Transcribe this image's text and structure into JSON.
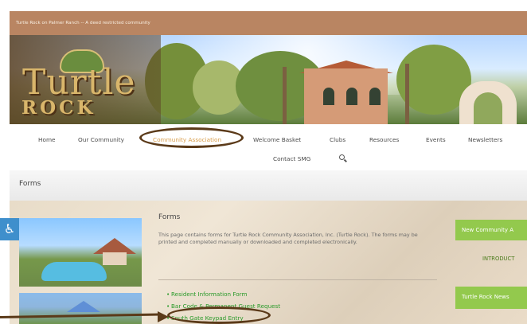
{
  "header": {
    "tagline": "Turtle Rock on Palmer Ranch -- A deed restricted community"
  },
  "logo": {
    "line1": "Turtle",
    "line2": "ROCK"
  },
  "nav": {
    "items": [
      "Home",
      "Our Community",
      "Community Association",
      "Welcome Basket",
      "Clubs",
      "Resources",
      "Events",
      "Newsletters",
      "Contact SMG"
    ],
    "search_icon": "search-icon"
  },
  "title_strip": {
    "title": "Forms"
  },
  "main": {
    "heading": "Forms",
    "paragraph": "This page contains forms for Turtle Rock Community Association, Inc. (Turtle Rock). The forms may be printed and completed manually or downloaded and completed electronically.",
    "links": [
      "Resident Information Form",
      "Bar Code & Permanent Guest Request",
      "South Gate Keypad Entry"
    ]
  },
  "sidebar": {
    "card1": "New Community A",
    "card1_sub": "INTRODUCT",
    "card2": "Turtle Rock News"
  },
  "colors": {
    "top_bar": "#b98562",
    "link": "#2a9a2a",
    "sidebar": "#93c94d",
    "highlight": "#5b3a19"
  }
}
